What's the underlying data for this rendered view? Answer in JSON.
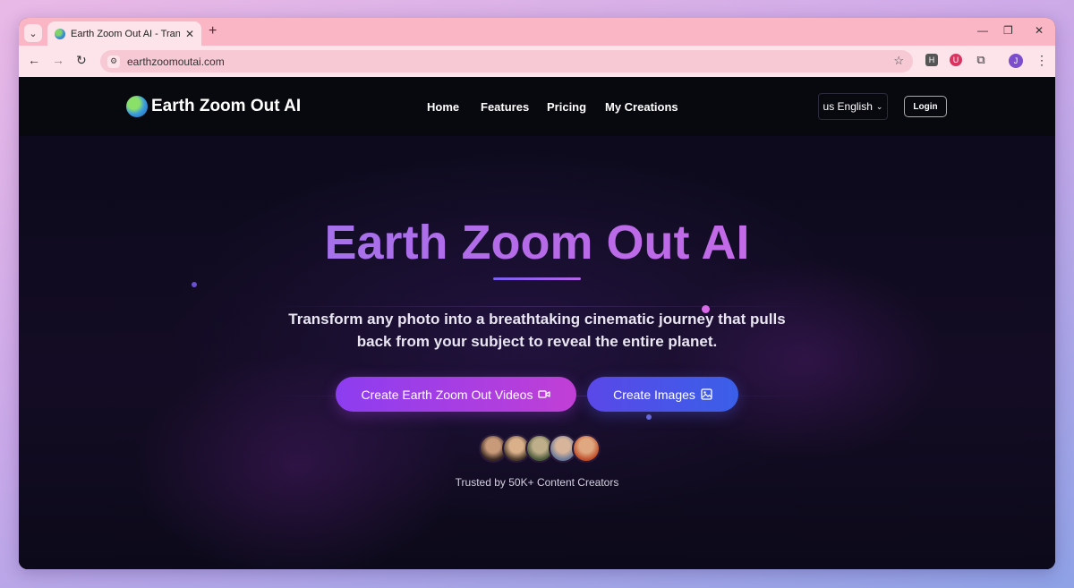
{
  "browser": {
    "tab_title": "Earth Zoom Out AI - Transform",
    "url": "earthzoomoutai.com",
    "profile_initial": "J",
    "extensions": [
      "H",
      "U"
    ]
  },
  "site": {
    "logo_text": "Earth Zoom Out AI",
    "nav": [
      "Home",
      "Features",
      "Pricing",
      "My Creations"
    ],
    "language": "us English",
    "login": "Login"
  },
  "hero": {
    "title": "Earth Zoom Out AI",
    "subtitle": "Transform any photo into a breathtaking cinematic journey that pulls back from your subject to reveal the entire planet.",
    "cta_primary": "Create Earth Zoom Out Videos",
    "cta_secondary": "Create Images",
    "trusted": "Trusted by 50K+ Content Creators"
  },
  "colors": {
    "tab_bar": "#fbb6c6",
    "page_bg": "#0a0a17",
    "primary_gradient_start": "#8c3df0",
    "primary_gradient_end": "#c13fd6",
    "secondary_gradient_start": "#5a48e8",
    "secondary_gradient_end": "#3a5fe8"
  }
}
